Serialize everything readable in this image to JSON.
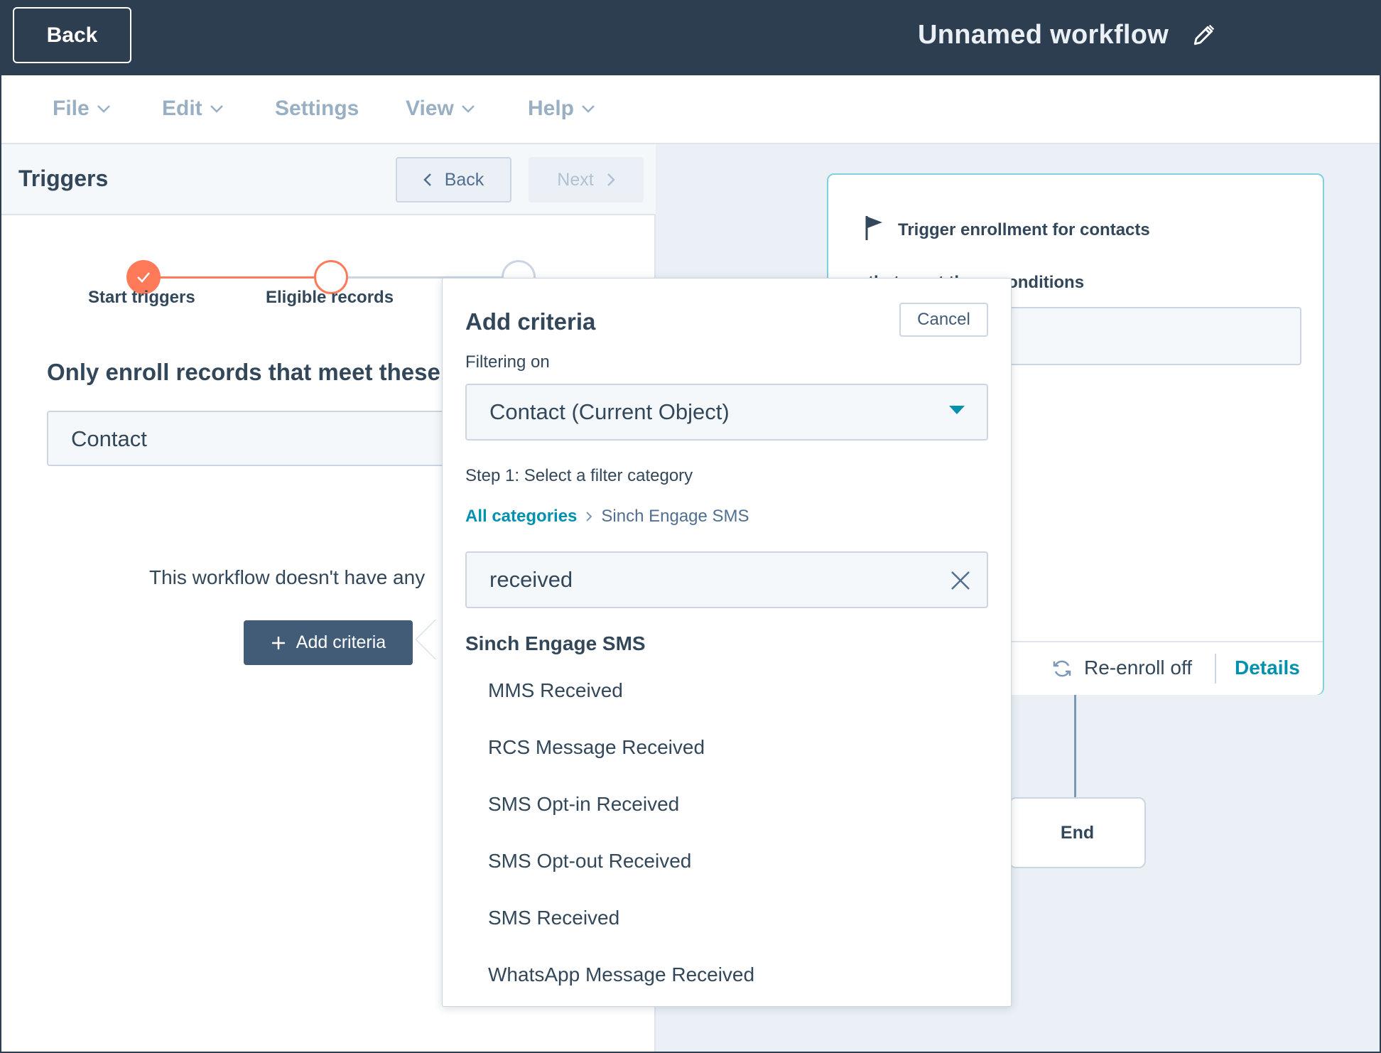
{
  "header": {
    "back_label": "Back",
    "workflow_title": "Unnamed workflow",
    "edit_icon": "pencil-icon"
  },
  "menu": {
    "items": [
      {
        "label": "File",
        "has_dropdown": true
      },
      {
        "label": "Edit",
        "has_dropdown": true
      },
      {
        "label": "Settings",
        "has_dropdown": false
      },
      {
        "label": "View",
        "has_dropdown": true
      },
      {
        "label": "Help",
        "has_dropdown": true
      }
    ]
  },
  "triggers_panel": {
    "title": "Triggers",
    "back_label": "Back",
    "next_label": "Next",
    "steps": [
      {
        "label": "Start triggers",
        "state": "complete"
      },
      {
        "label": "Eligible records",
        "state": "current"
      },
      {
        "label": "",
        "state": "upcoming"
      }
    ],
    "enroll_heading": "Only enroll records that meet these",
    "object_value": "Contact",
    "empty_text": "This workflow doesn't have any",
    "add_criteria_label": "Add criteria"
  },
  "trigger_card": {
    "title": "Trigger enrollment for contacts",
    "subtitle": "s that meet these conditions",
    "conditions_placeholder": "conditions",
    "reenroll_label": "Re-enroll off",
    "details_label": "Details"
  },
  "end_node": {
    "label": "End"
  },
  "add_criteria_popover": {
    "title": "Add criteria",
    "cancel_label": "Cancel",
    "filtering_on_label": "Filtering on",
    "object_selected": "Contact (Current Object)",
    "step_text": "Step 1: Select a filter category",
    "breadcrumb": {
      "root": "All categories",
      "current": "Sinch Engage SMS"
    },
    "search_value": "received",
    "group_label": "Sinch Engage SMS",
    "results": [
      "MMS Received",
      "RCS Message Received",
      "SMS Opt-in Received",
      "SMS Opt-out Received",
      "SMS Received",
      "WhatsApp Message Received"
    ]
  },
  "colors": {
    "header_bg": "#2d3e50",
    "accent_orange": "#ff7a59",
    "link_teal": "#0091ae",
    "primary_button": "#425b76",
    "canvas_bg": "#eaf0f6"
  }
}
